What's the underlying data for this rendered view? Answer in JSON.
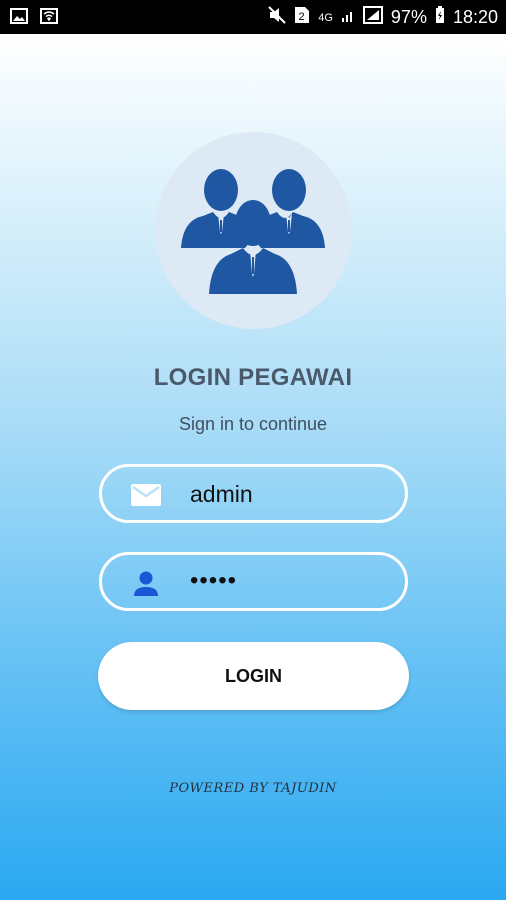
{
  "status_bar": {
    "battery": "97%",
    "time": "18:20",
    "sim": "2",
    "network": "4G"
  },
  "login": {
    "title": "LOGIN PEGAWAI",
    "subtitle": "Sign in to continue",
    "email_value": "admin",
    "password_value": "•••••",
    "button_label": "LOGIN"
  },
  "footer": {
    "text": "POWERED BY TAJUDIN"
  },
  "colors": {
    "icon_blue": "#1f57a3",
    "title_text": "#4a5a6a",
    "gradient_bottom": "#2aa8f1"
  }
}
